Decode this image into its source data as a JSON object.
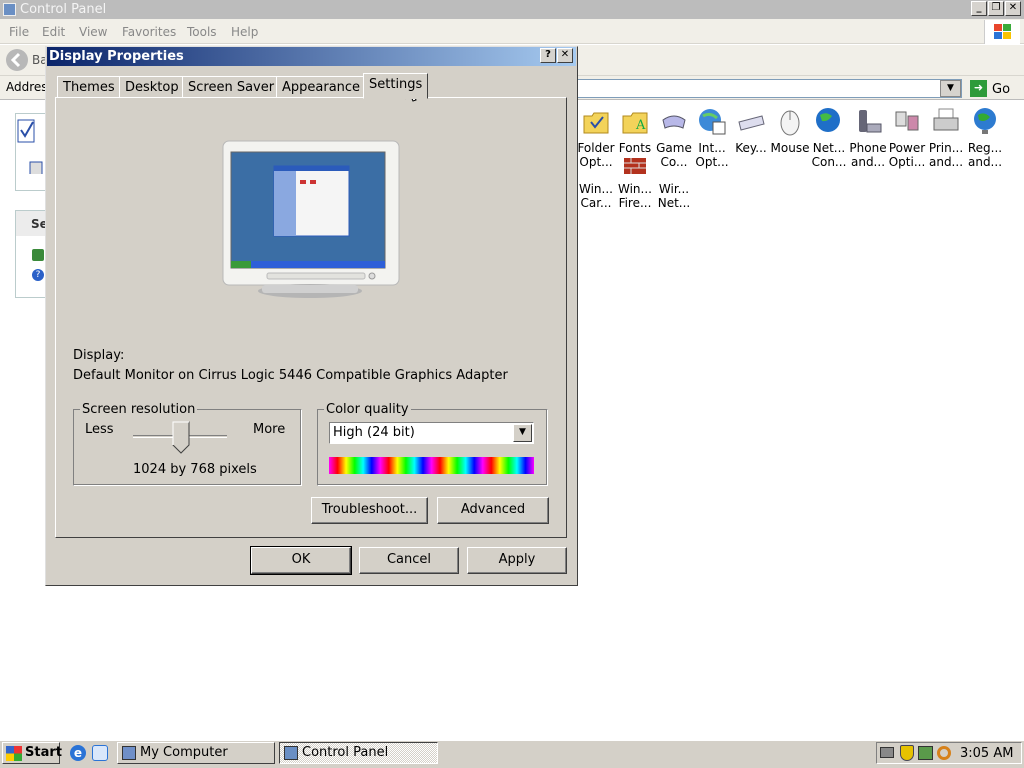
{
  "window": {
    "title": "Control Panel"
  },
  "menu": [
    "File",
    "Edit",
    "View",
    "Favorites",
    "Tools",
    "Help"
  ],
  "toolbar": {
    "back_label": "Ba"
  },
  "address": {
    "label": "Addres",
    "go_label": "Go"
  },
  "left_pane": {
    "header": "Se"
  },
  "icons": [
    {
      "line1": "Folder",
      "line2": "Opt..."
    },
    {
      "line1": "Fonts",
      "line2": ""
    },
    {
      "line1": "Game",
      "line2": "Co..."
    },
    {
      "line1": "Int...",
      "line2": "Opt..."
    },
    {
      "line1": "Key...",
      "line2": ""
    },
    {
      "line1": "Mouse",
      "line2": ""
    },
    {
      "line1": "Net...",
      "line2": "Con..."
    },
    {
      "line1": "Phone",
      "line2": "and..."
    },
    {
      "line1": "Power",
      "line2": "Opti..."
    },
    {
      "line1": "Prin...",
      "line2": "and..."
    },
    {
      "line1": "Reg...",
      "line2": "and..."
    },
    {
      "line1": "Win...",
      "line2": "Car..."
    },
    {
      "line1": "Win...",
      "line2": "Fire..."
    },
    {
      "line1": "Wir...",
      "line2": "Net..."
    }
  ],
  "dialog": {
    "title": "Display Properties",
    "help_btn": "?",
    "close_btn": "✕",
    "tabs": [
      "Themes",
      "Desktop",
      "Screen Saver",
      "Appearance",
      "Settings"
    ],
    "display_label": "Display:",
    "display_value": "Default Monitor on Cirrus Logic 5446 Compatible Graphics Adapter",
    "resolution": {
      "legend": "Screen resolution",
      "less": "Less",
      "more": "More",
      "value": "1024 by 768 pixels"
    },
    "color_quality": {
      "legend": "Color quality",
      "selected": "High (24 bit)"
    },
    "troubleshoot_label": "Troubleshoot...",
    "advanced_label": "Advanced",
    "ok_label": "OK",
    "cancel_label": "Cancel",
    "apply_label": "Apply"
  },
  "taskbar": {
    "start_label": "Start",
    "tasks": [
      "My Computer",
      "Control Panel"
    ],
    "clock": "3:05 AM"
  }
}
